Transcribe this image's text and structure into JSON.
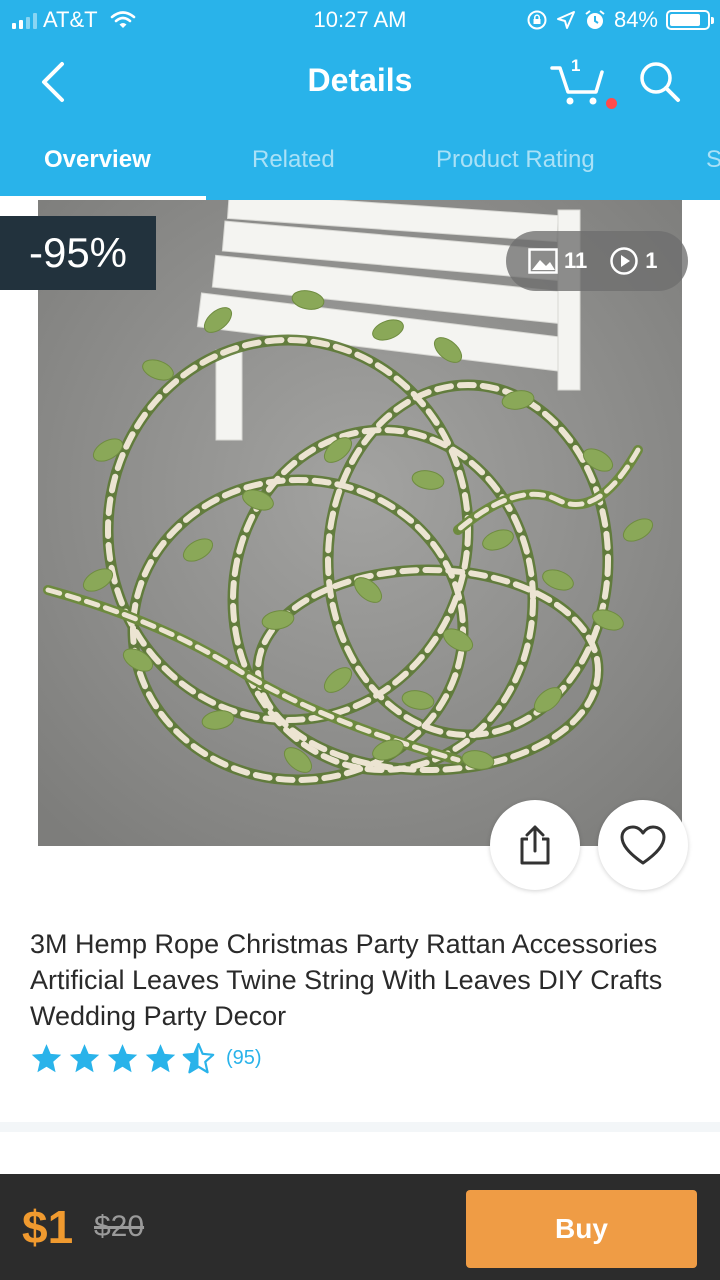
{
  "status_bar": {
    "carrier": "AT&T",
    "time": "10:27 AM",
    "battery_percent": "84%",
    "battery_level": 0.84,
    "icons": [
      "signal-icon",
      "wifi-icon",
      "rotation-lock-icon",
      "location-icon",
      "alarm-icon",
      "battery-icon"
    ]
  },
  "header": {
    "title": "Details",
    "cart_count": "1",
    "icons": [
      "back-icon",
      "cart-icon",
      "search-icon"
    ]
  },
  "tabs": [
    {
      "label": "Overview",
      "active": true
    },
    {
      "label": "Related",
      "active": false
    },
    {
      "label": "Product Rating",
      "active": false
    },
    {
      "label": "S",
      "active": false
    }
  ],
  "media": {
    "discount_badge": "-95%",
    "image_count": "11",
    "video_count": "1",
    "icons": [
      "image-icon",
      "play-icon",
      "share-icon",
      "heart-icon"
    ]
  },
  "product": {
    "title": "3M Hemp Rope Christmas Party Rattan Accessories Artificial Leaves Twine String With Leaves DIY Crafts Wedding Party Decor",
    "rating": 4.5,
    "rating_max": 5,
    "review_count": "(95)"
  },
  "purchase": {
    "price": "$1",
    "original_price": "$20",
    "buy_label": "Buy"
  },
  "colors": {
    "brand_blue": "#29b3ea",
    "price_orange": "#f09a2f",
    "buy_button": "#ef9c45",
    "discount_badge_bg": "#22323d",
    "bottom_bar": "#2c2c2c"
  }
}
